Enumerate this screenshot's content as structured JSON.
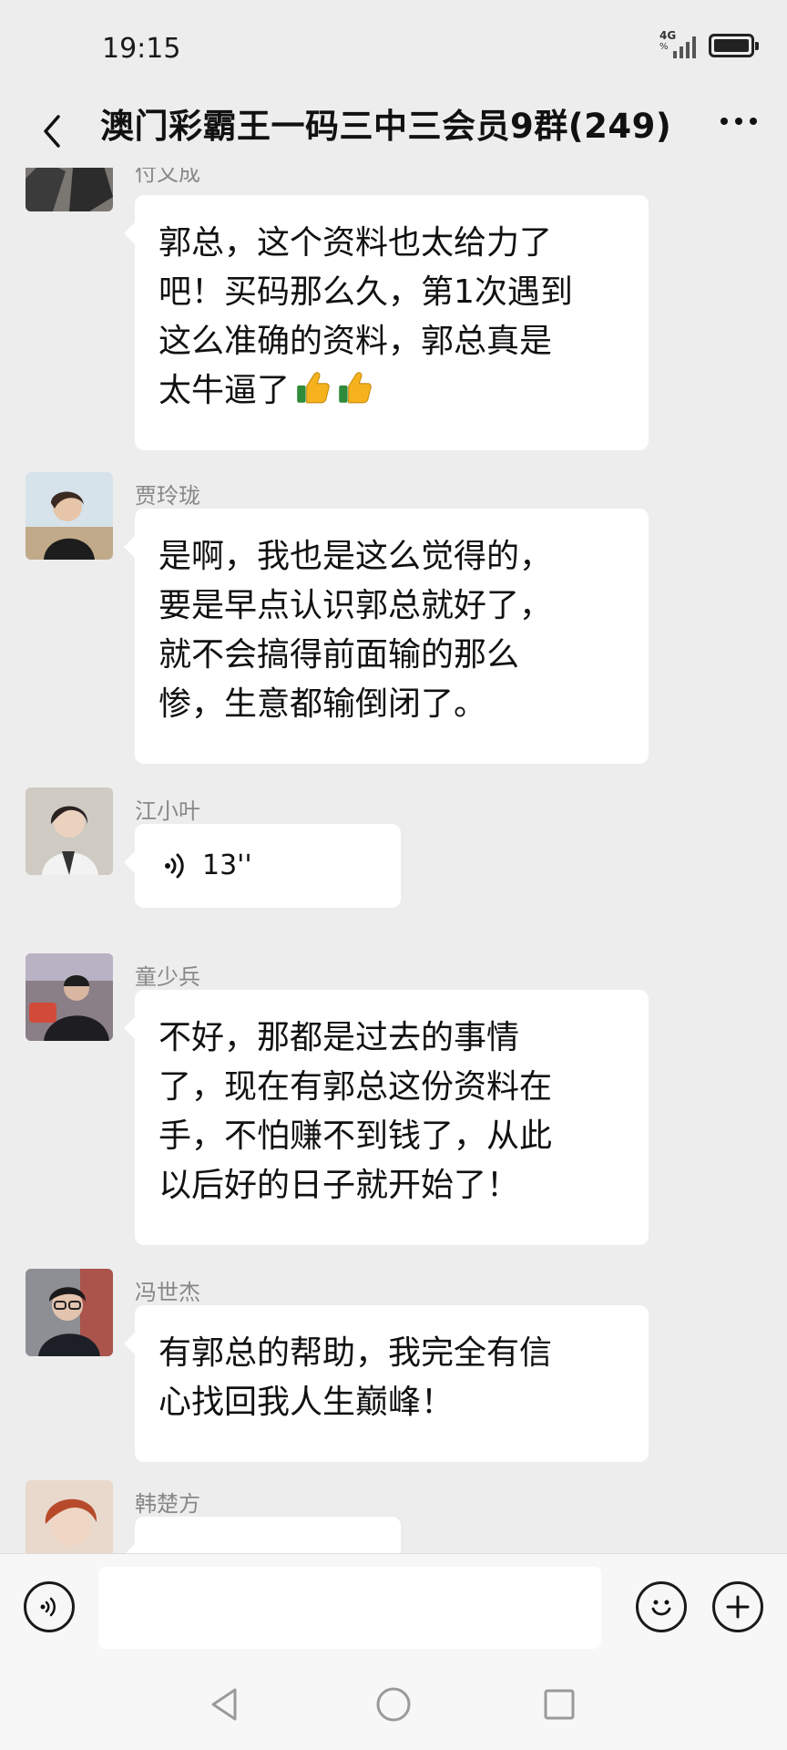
{
  "status": {
    "time": "19:15",
    "network": "4G",
    "network_sub": "%"
  },
  "header": {
    "title": "澳门彩霸王一码三中三会员9群(249)"
  },
  "messages": [
    {
      "sender": "付文成",
      "lines": [
        "郭总，这个资料也太给力了",
        "吧！买码那么久，第1次遇到",
        "这么准确的资料，郭总真是",
        "太牛逼了"
      ],
      "emoji": "thumbs-up-icon x2"
    },
    {
      "sender": "贾玲珑",
      "lines": [
        "是啊，我也是这么觉得的，",
        "要是早点认识郭总就好了，",
        "就不会搞得前面输的那么",
        "惨，生意都输倒闭了。"
      ]
    },
    {
      "sender": "江小叶",
      "voice_duration": "13''"
    },
    {
      "sender": "童少兵",
      "lines": [
        "不好，那都是过去的事情",
        "了，现在有郭总这份资料在",
        "手，不怕赚不到钱了，从此",
        "以后好的日子就开始了！"
      ]
    },
    {
      "sender": "冯世杰",
      "lines": [
        "有郭总的帮助，我完全有信",
        "心找回我人生巅峰！"
      ]
    },
    {
      "sender": "韩楚方"
    }
  ],
  "input": {
    "placeholder": ""
  },
  "colors": {
    "background": "#ededed",
    "bubble": "#ffffff",
    "sender": "#888888"
  }
}
